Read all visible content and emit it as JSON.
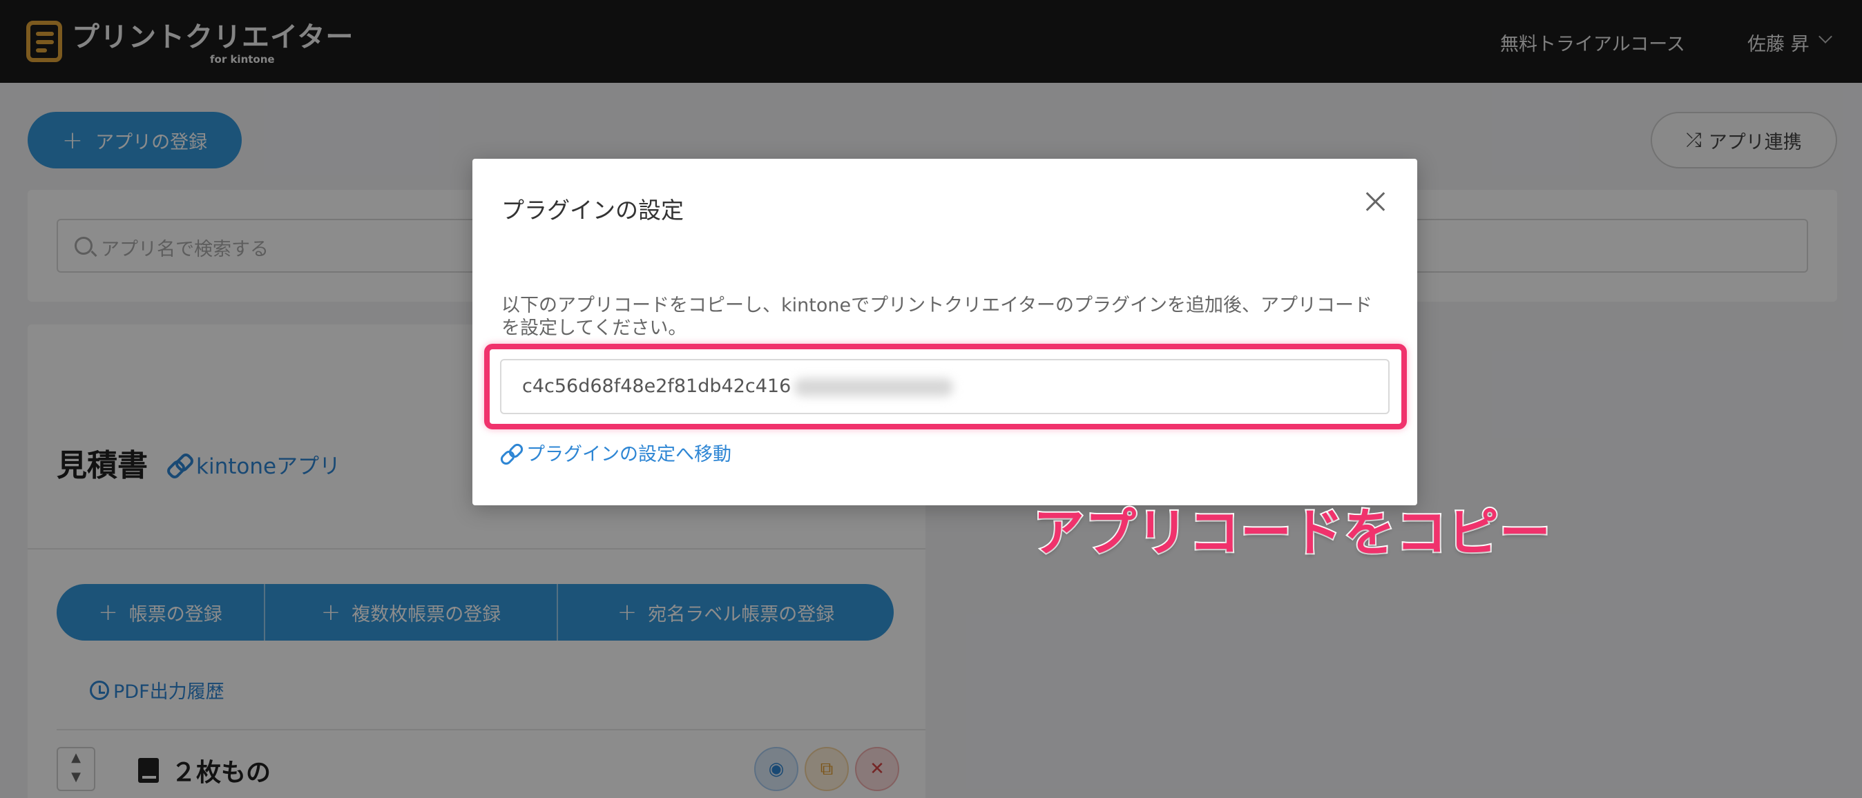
{
  "header": {
    "logo_text": "プリントクリエイター",
    "logo_sub": "for kintone",
    "trial": "無料トライアルコース",
    "user": "佐藤 昇"
  },
  "toolbar": {
    "register_label": "アプリの登録",
    "link_label": "アプリ連携"
  },
  "search": {
    "placeholder": "アプリ名で検索する"
  },
  "app": {
    "title": "見積書",
    "kintone_link": "kintoneアプリ",
    "buttons": [
      "帳票の登録",
      "複数枚帳票の登録",
      "宛名ラベル帳票の登録"
    ],
    "pdf_history": "PDF出力履歴",
    "form_name": "２枚もの"
  },
  "modal": {
    "title": "プラグインの設定",
    "description": "以下のアプリコードをコピーし、kintoneでプリントクリエイターのプラグインを追加後、アプリコードを設定してください。",
    "code_visible": "c4c56d68f48e2f81db42c416",
    "plugin_link": "プラグインの設定へ移動"
  },
  "annotation": "アプリコードをコピー",
  "colors": {
    "primary": "#3498db",
    "link": "#2e86d4",
    "highlight": "#f0326c",
    "header_bg": "#1a1a1a",
    "logo_accent": "#e2a53a"
  }
}
